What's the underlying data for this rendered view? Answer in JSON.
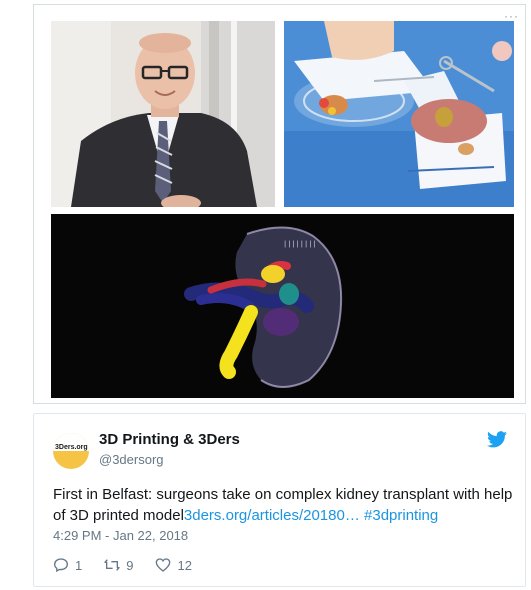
{
  "tweet": {
    "avatar_label": "3Ders.org",
    "display_name": "3D Printing & 3Ders",
    "handle": "@3dersorg",
    "text": "First in Belfast: surgeons take on complex kidney transplant with help of 3D printed model",
    "link": "3ders.org/articles/20180…",
    "hashtag": "#3dprinting",
    "timestamp": "4:29 PM - Jan 22, 2018",
    "reply_count": "1",
    "retweet_count": "9",
    "like_count": "12"
  },
  "colors": {
    "link": "#1b95e0",
    "muted": "#657786",
    "avatar_yellow": "#f6c445",
    "twitter_blue": "#1da1f2"
  },
  "icons": [
    "more-dots-icon",
    "twitter-bird-icon",
    "reply-icon",
    "retweet-icon",
    "heart-icon"
  ]
}
